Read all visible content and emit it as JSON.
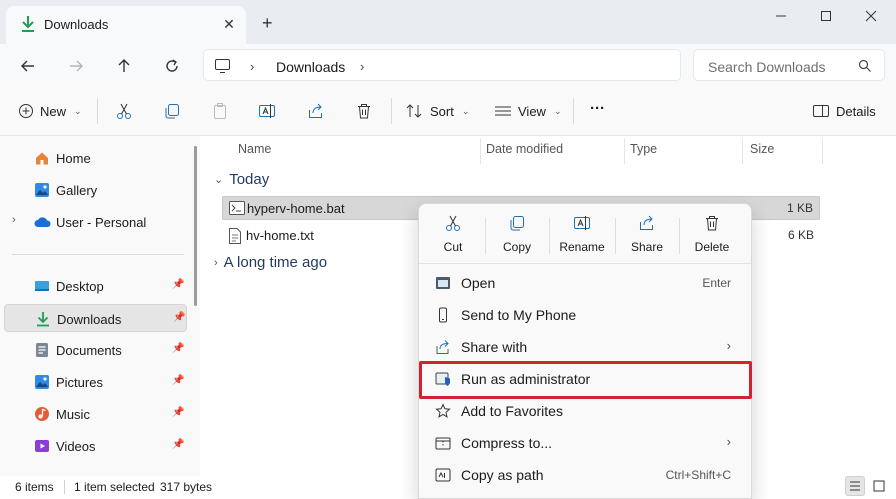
{
  "window": {
    "tab_title": "Downloads",
    "tab_close": "✕",
    "new_tab": "+",
    "controls": [
      "minimize-icon",
      "maximize-icon",
      "close-icon"
    ]
  },
  "nav": {
    "breadcrumb": "Downloads",
    "search_placeholder": "Search Downloads"
  },
  "commands": {
    "new_label": "New",
    "sort_label": "Sort",
    "view_label": "View",
    "more_label": "···",
    "details_label": "Details"
  },
  "sidebar": {
    "items": [
      {
        "label": "Home",
        "icon": "home-icon"
      },
      {
        "label": "Gallery",
        "icon": "gallery-icon"
      },
      {
        "label": "User - Personal",
        "icon": "onedrive-icon"
      },
      {
        "label": "Desktop",
        "icon": "desktop-icon"
      },
      {
        "label": "Downloads",
        "icon": "downloads-icon"
      },
      {
        "label": "Documents",
        "icon": "documents-icon"
      },
      {
        "label": "Pictures",
        "icon": "pictures-icon"
      },
      {
        "label": "Music",
        "icon": "music-icon"
      },
      {
        "label": "Videos",
        "icon": "videos-icon"
      }
    ]
  },
  "files": {
    "columns": [
      "Name",
      "Date modified",
      "Type",
      "Size"
    ],
    "groups": [
      {
        "label": "Today"
      },
      {
        "label": "A long time ago"
      }
    ],
    "rows": [
      {
        "name": "hyperv-home.bat",
        "size": "1 KB"
      },
      {
        "name": "hv-home.txt",
        "size": "6 KB"
      }
    ]
  },
  "status": {
    "count": "6 items",
    "selection": "1 item selected",
    "bytes": "317 bytes"
  },
  "context_menu": {
    "quick_actions": [
      {
        "label": "Cut"
      },
      {
        "label": "Copy"
      },
      {
        "label": "Rename"
      },
      {
        "label": "Share"
      },
      {
        "label": "Delete"
      }
    ],
    "items": [
      {
        "label": "Open",
        "shortcut": "Enter"
      },
      {
        "label": "Send to My Phone"
      },
      {
        "label": "Share with",
        "arrow": "›"
      },
      {
        "label": "Run as administrator"
      },
      {
        "label": "Add to Favorites"
      },
      {
        "label": "Compress to...",
        "arrow": "›"
      },
      {
        "label": "Copy as path",
        "shortcut": "Ctrl+Shift+C"
      }
    ]
  },
  "colors": {
    "accent": "#0078d4",
    "highlight_border": "#d1232f",
    "download_green": "#1e9e56"
  }
}
